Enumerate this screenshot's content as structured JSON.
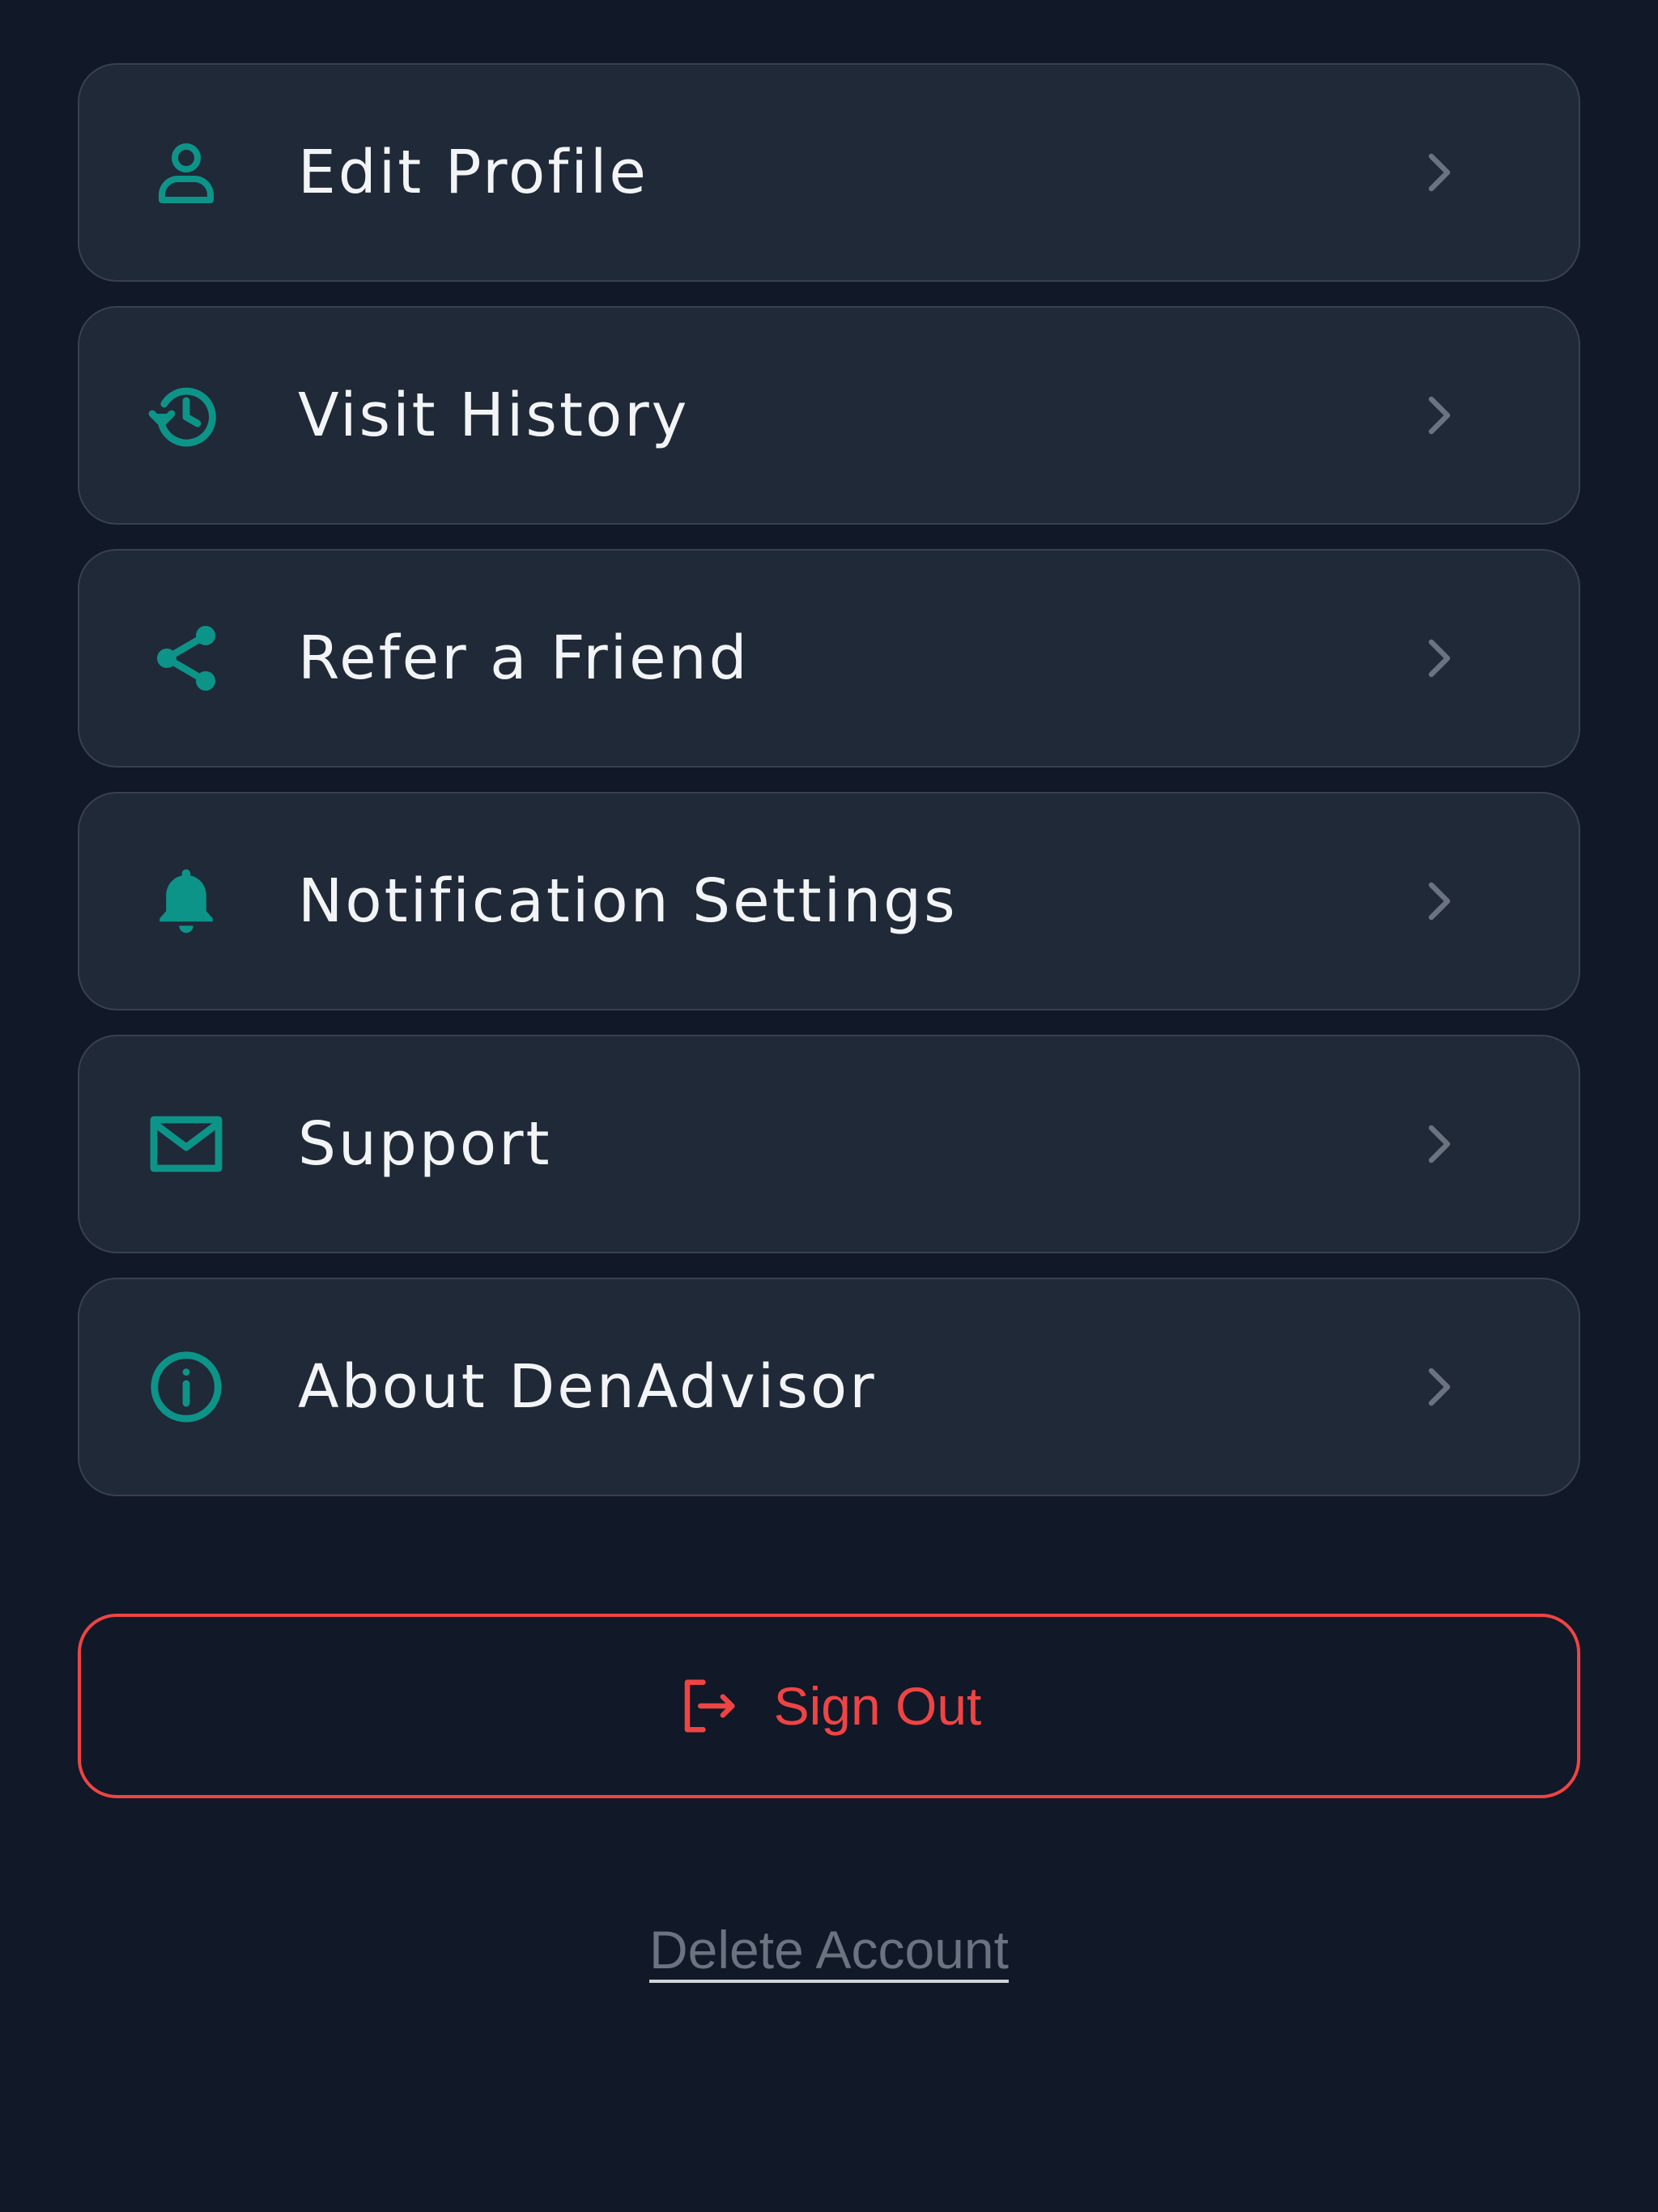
{
  "colors": {
    "background": "#111827",
    "card": "#1f2937",
    "card_border": "#374151",
    "accent": "#0d9488",
    "text": "#f3f4f6",
    "chevron": "#6b7280",
    "danger": "#ef4444",
    "muted": "#6b7280"
  },
  "menu": {
    "items": [
      {
        "label": "Edit Profile",
        "icon": "user-icon"
      },
      {
        "label": "Visit History",
        "icon": "history-icon"
      },
      {
        "label": "Refer a Friend",
        "icon": "share-icon"
      },
      {
        "label": "Notification Settings",
        "icon": "bell-icon"
      },
      {
        "label": "Support",
        "icon": "mail-icon"
      },
      {
        "label": "About DenAdvisor",
        "icon": "info-icon"
      }
    ]
  },
  "signout": {
    "label": "Sign Out",
    "icon": "logout-icon"
  },
  "delete_account": {
    "label": "Delete Account"
  }
}
